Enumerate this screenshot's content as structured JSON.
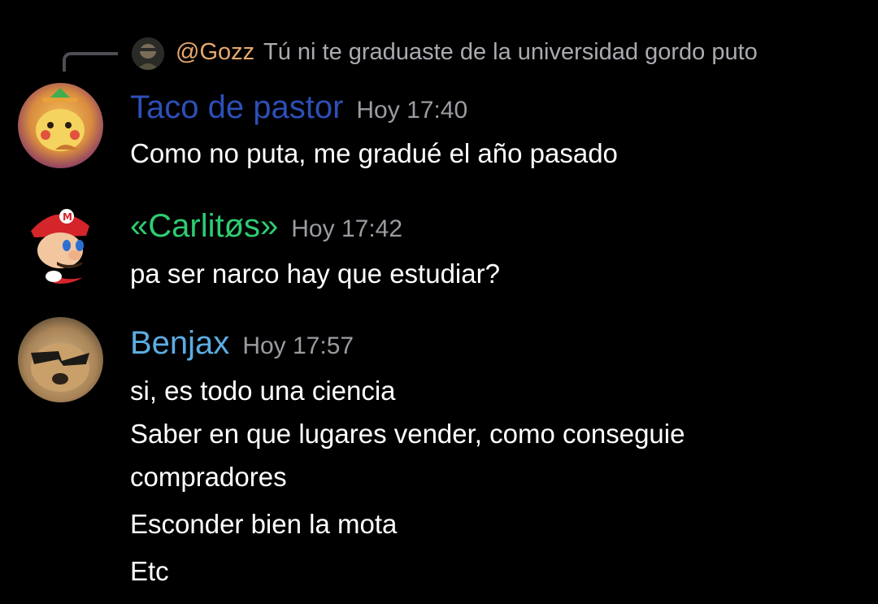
{
  "reply": {
    "author": "@Gozz",
    "text": "Tú ni te graduaste de la universidad gordo puto",
    "author_color": "#e7a86d"
  },
  "messages": [
    {
      "author": "Taco de pastor",
      "author_color": "#2d4fb8",
      "timestamp": "Hoy 17:40",
      "lines": [
        "Como no puta, me gradué el año pasado"
      ]
    },
    {
      "author": "«Carlitøs»",
      "author_color": "#2ecc71",
      "timestamp": "Hoy 17:42",
      "lines": [
        "pa ser narco hay que estudiar?"
      ]
    },
    {
      "author": "Benjax",
      "author_color": "#5dade2",
      "timestamp": "Hoy 17:57",
      "lines": [
        "si, es todo una ciencia",
        "Saber en que lugares vender, como conseguie",
        "compradores",
        "Esconder bien la mota",
        "Etc"
      ]
    }
  ]
}
